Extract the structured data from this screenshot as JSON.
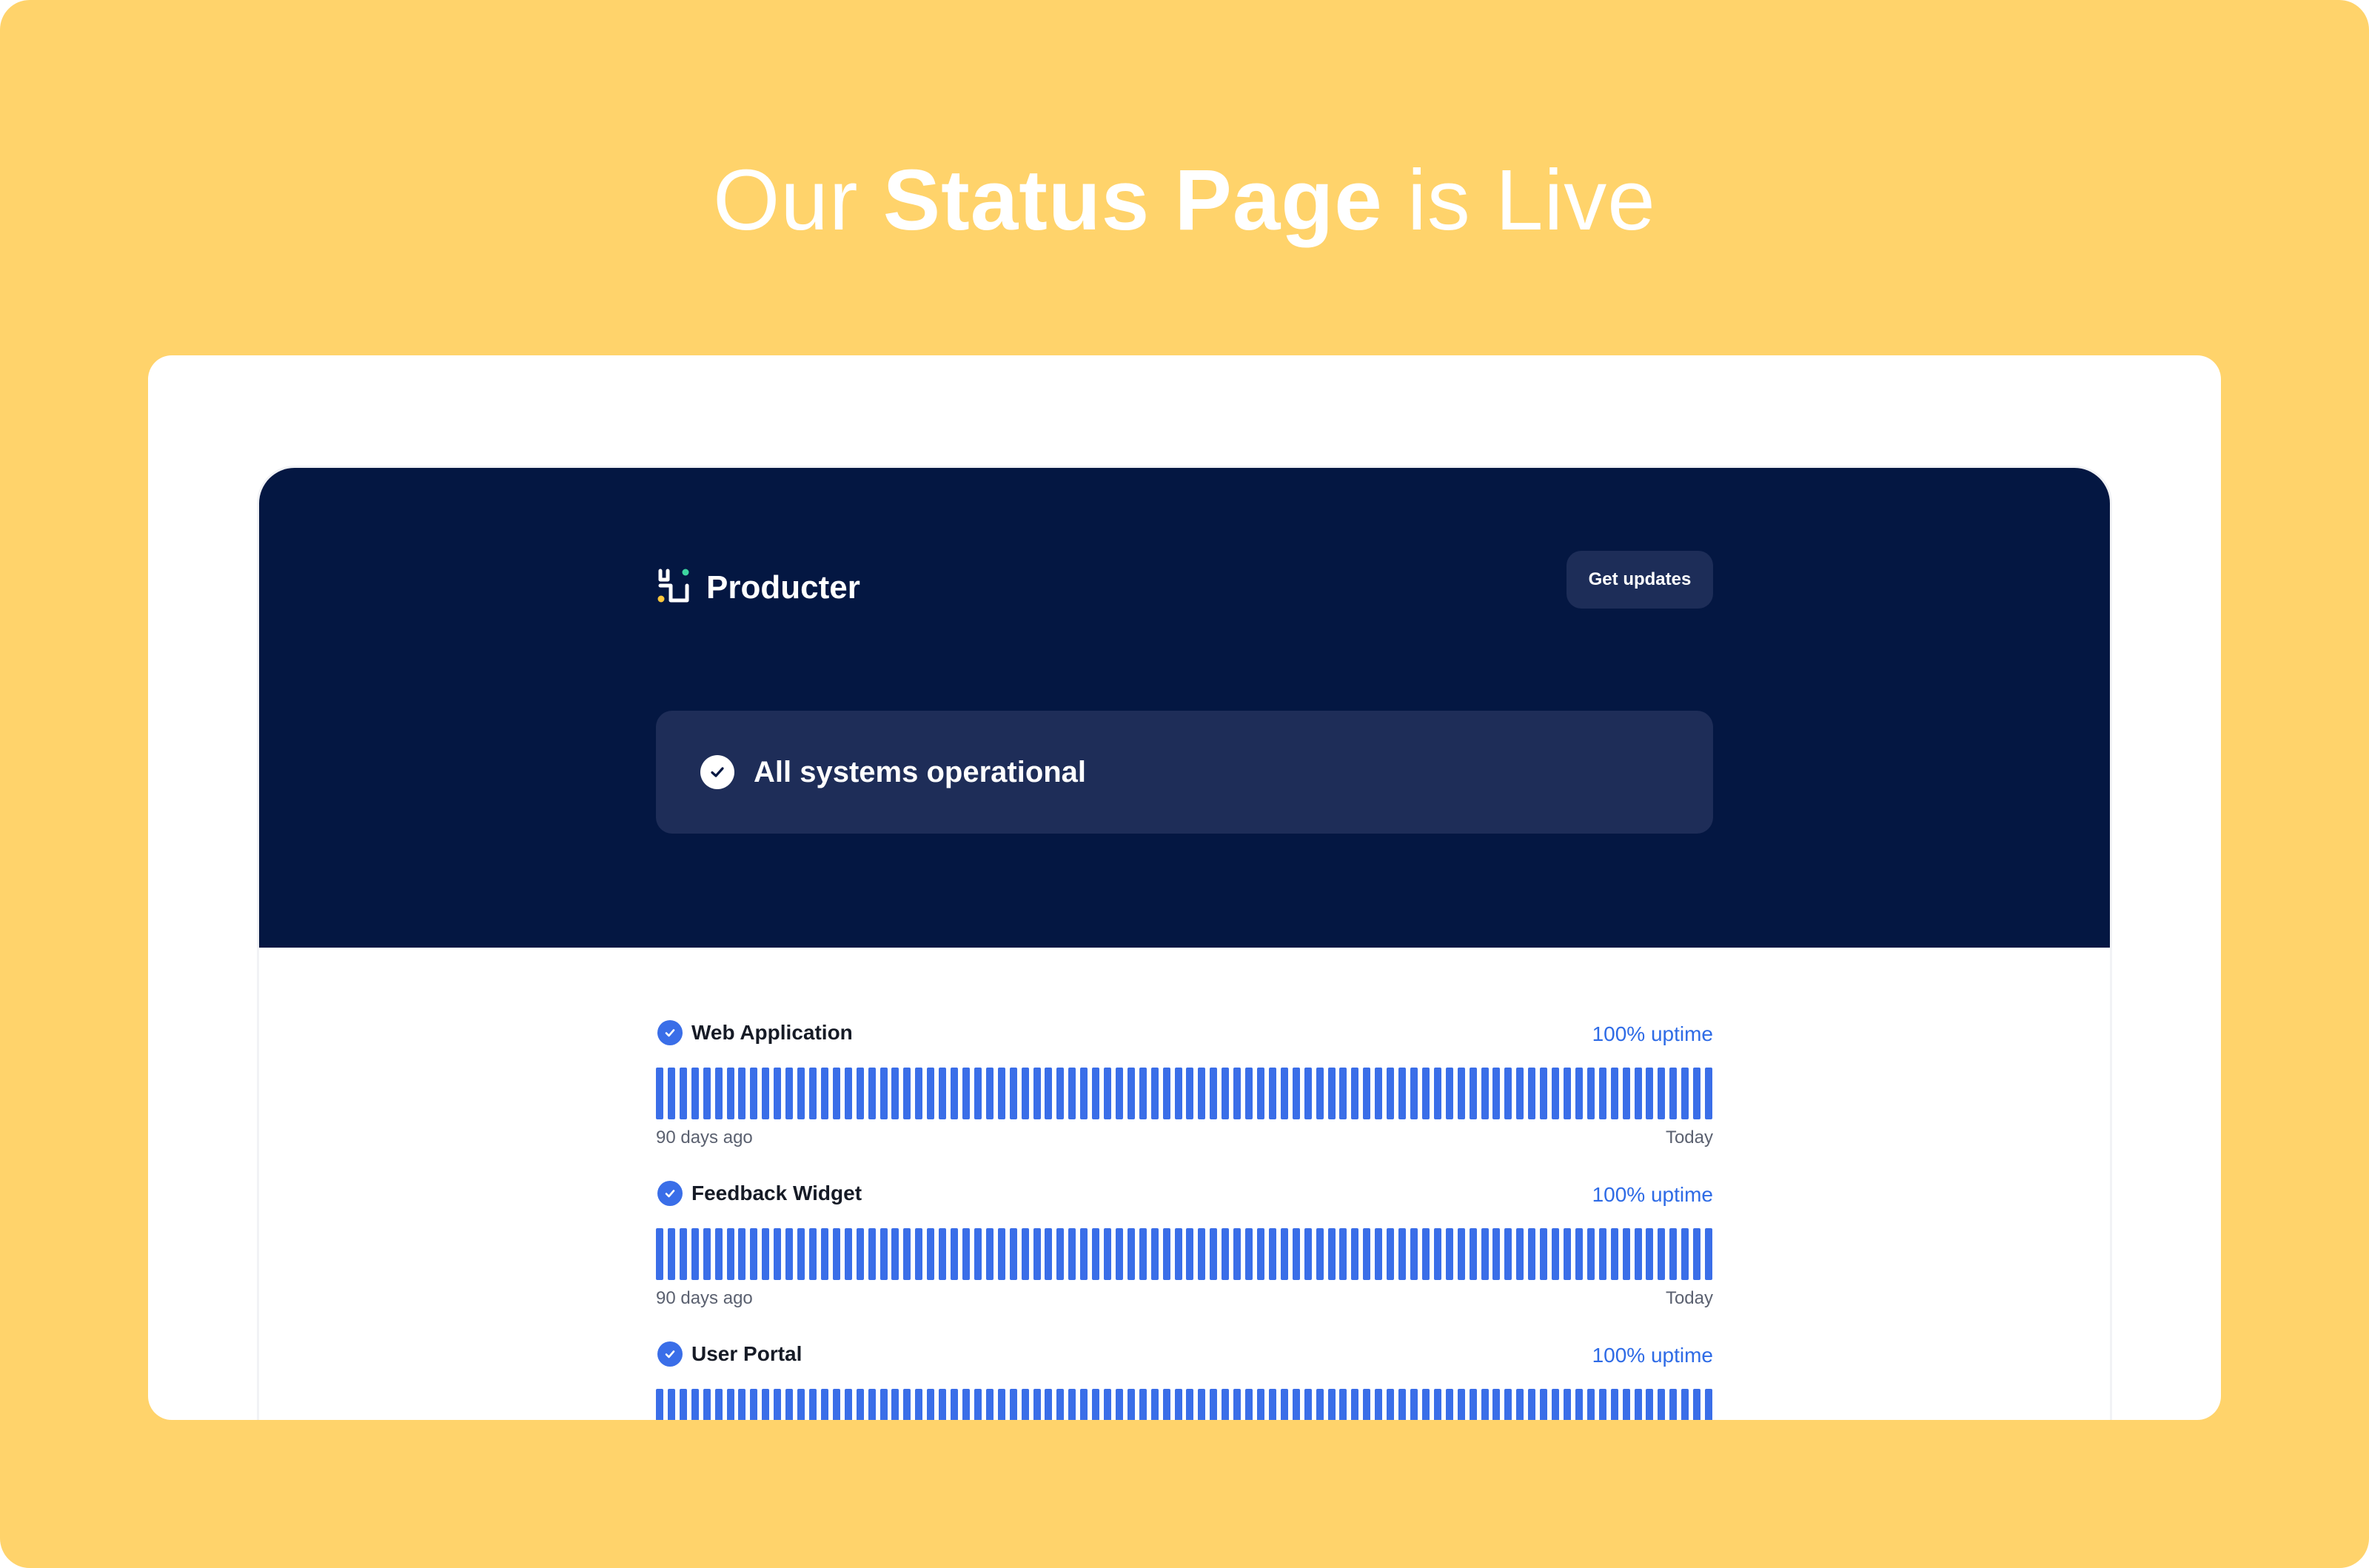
{
  "headline": {
    "prefix": "Our",
    "bold": "Status Page",
    "suffix": "is Live"
  },
  "brand": {
    "name": "Producter",
    "icon": "producter-logo-icon"
  },
  "header": {
    "updates_button": "Get updates"
  },
  "status": {
    "text": "All systems operational",
    "icon": "check-circle-icon"
  },
  "services": [
    {
      "name": "Web Application",
      "uptime": "100% uptime",
      "start_label": "90 days ago",
      "end_label": "Today",
      "days": 90,
      "operational_days": 90
    },
    {
      "name": "Feedback Widget",
      "uptime": "100% uptime",
      "start_label": "90 days ago",
      "end_label": "Today",
      "days": 90,
      "operational_days": 90
    },
    {
      "name": "User Portal",
      "uptime": "100% uptime",
      "start_label": "",
      "end_label": "",
      "days": 90,
      "operational_days": 90
    }
  ],
  "colors": {
    "frame_background": "#FFD36B",
    "hero_background": "#041742",
    "status_banner": "#1E2D58",
    "bar_operational": "#3A6EE8",
    "uptime_text": "#2E6BE6",
    "logo_green": "#3DD6A0",
    "logo_yellow": "#FFC83D"
  }
}
